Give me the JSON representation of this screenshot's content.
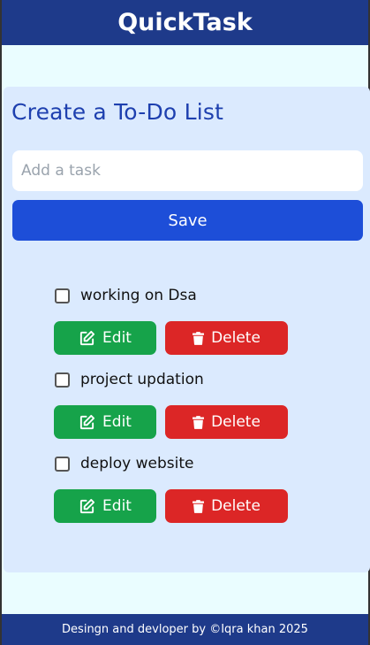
{
  "header": {
    "title": "QuickTask"
  },
  "main": {
    "heading": "Create a To-Do List",
    "input": {
      "placeholder": "Add a task",
      "value": ""
    },
    "save_label": "Save"
  },
  "tasks": [
    {
      "text": "working on Dsa",
      "checked": false,
      "edit_label": "Edit",
      "delete_label": "Delete"
    },
    {
      "text": "project updation",
      "checked": false,
      "edit_label": "Edit",
      "delete_label": "Delete"
    },
    {
      "text": "deploy website",
      "checked": false,
      "edit_label": "Edit",
      "delete_label": "Delete"
    }
  ],
  "footer": {
    "credit": "Desingn and devloper by ©Iqra khan 2025"
  },
  "colors": {
    "header_bg": "#1e3a8a",
    "card_bg": "#dbeafe",
    "save": "#1d4ed8",
    "edit": "#16a34a",
    "delete": "#dc2626"
  },
  "icons": {
    "edit": "pencil-square-icon",
    "delete": "trash-icon"
  }
}
